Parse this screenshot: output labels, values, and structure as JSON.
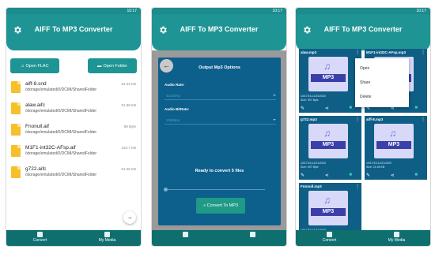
{
  "status_time": "10:17",
  "app_title": "AIFF To MP3 Converter",
  "nav": {
    "convert": "Convert",
    "my_media": "My Media"
  },
  "screen1": {
    "btn_open_flac": "Open FLAC",
    "btn_open_folder": "Open Folder",
    "files": [
      {
        "name": "aiff-8.snd",
        "path": "/storage/emulated/0/DCIM/SharedFolder",
        "size": "64.32 KB"
      },
      {
        "name": "alaw.aifc",
        "path": "/storage/emulated/0/DCIM/SharedFolder",
        "size": "01.88 KB"
      },
      {
        "name": "Fnonull.aif",
        "path": "/storage/emulated/0/DCIM/SharedFolder",
        "size": "89 Byte"
      },
      {
        "name": "M1F1-int32C-AFsp.aif",
        "path": "/storage/emulated/0/DCIM/SharedFolder",
        "size": "163.7 KB"
      },
      {
        "name": "g722.aifc",
        "path": "/storage/emulated/0/DCIM/SharedFolder",
        "size": "01.05 KB"
      }
    ]
  },
  "screen2": {
    "dialog_title": "Output Mp3 Options",
    "audio_rate_label": "Audio Rate:",
    "audio_rate_value": "44100Hz",
    "audio_bitrate_label": "Audio BitRate:",
    "audio_bitrate_value": "128kbps",
    "ready_text": "Ready to convert 5 files",
    "convert_button": "Convert To MP3"
  },
  "screen3": {
    "cards": [
      {
        "name": "alaw.mp3",
        "date": "10/17/16-11/20/2020",
        "size": "Size: 907 Byte"
      },
      {
        "name": "M1F1-int32C-AFsp.mp3",
        "date": "10/17/16-11/21/2020",
        "size": "Size: 42.63 KB"
      },
      {
        "name": "g722.mp3",
        "date": "10/17/16-11/21/2020",
        "size": "Size: 907 Byte"
      },
      {
        "name": "aiff-8.mp3",
        "date": "10/17/16-11/21/2020",
        "size": "Size: 21.69 KB"
      },
      {
        "name": "Fnonull.mp3",
        "date": "10/17/16-11/21/2020",
        "size": "Size: 907 Byte"
      }
    ],
    "menu": [
      "Open",
      "Share",
      "Delete"
    ]
  },
  "colors": {
    "teal": "#1f9494",
    "dialog_blue": "#0d5f8c"
  }
}
